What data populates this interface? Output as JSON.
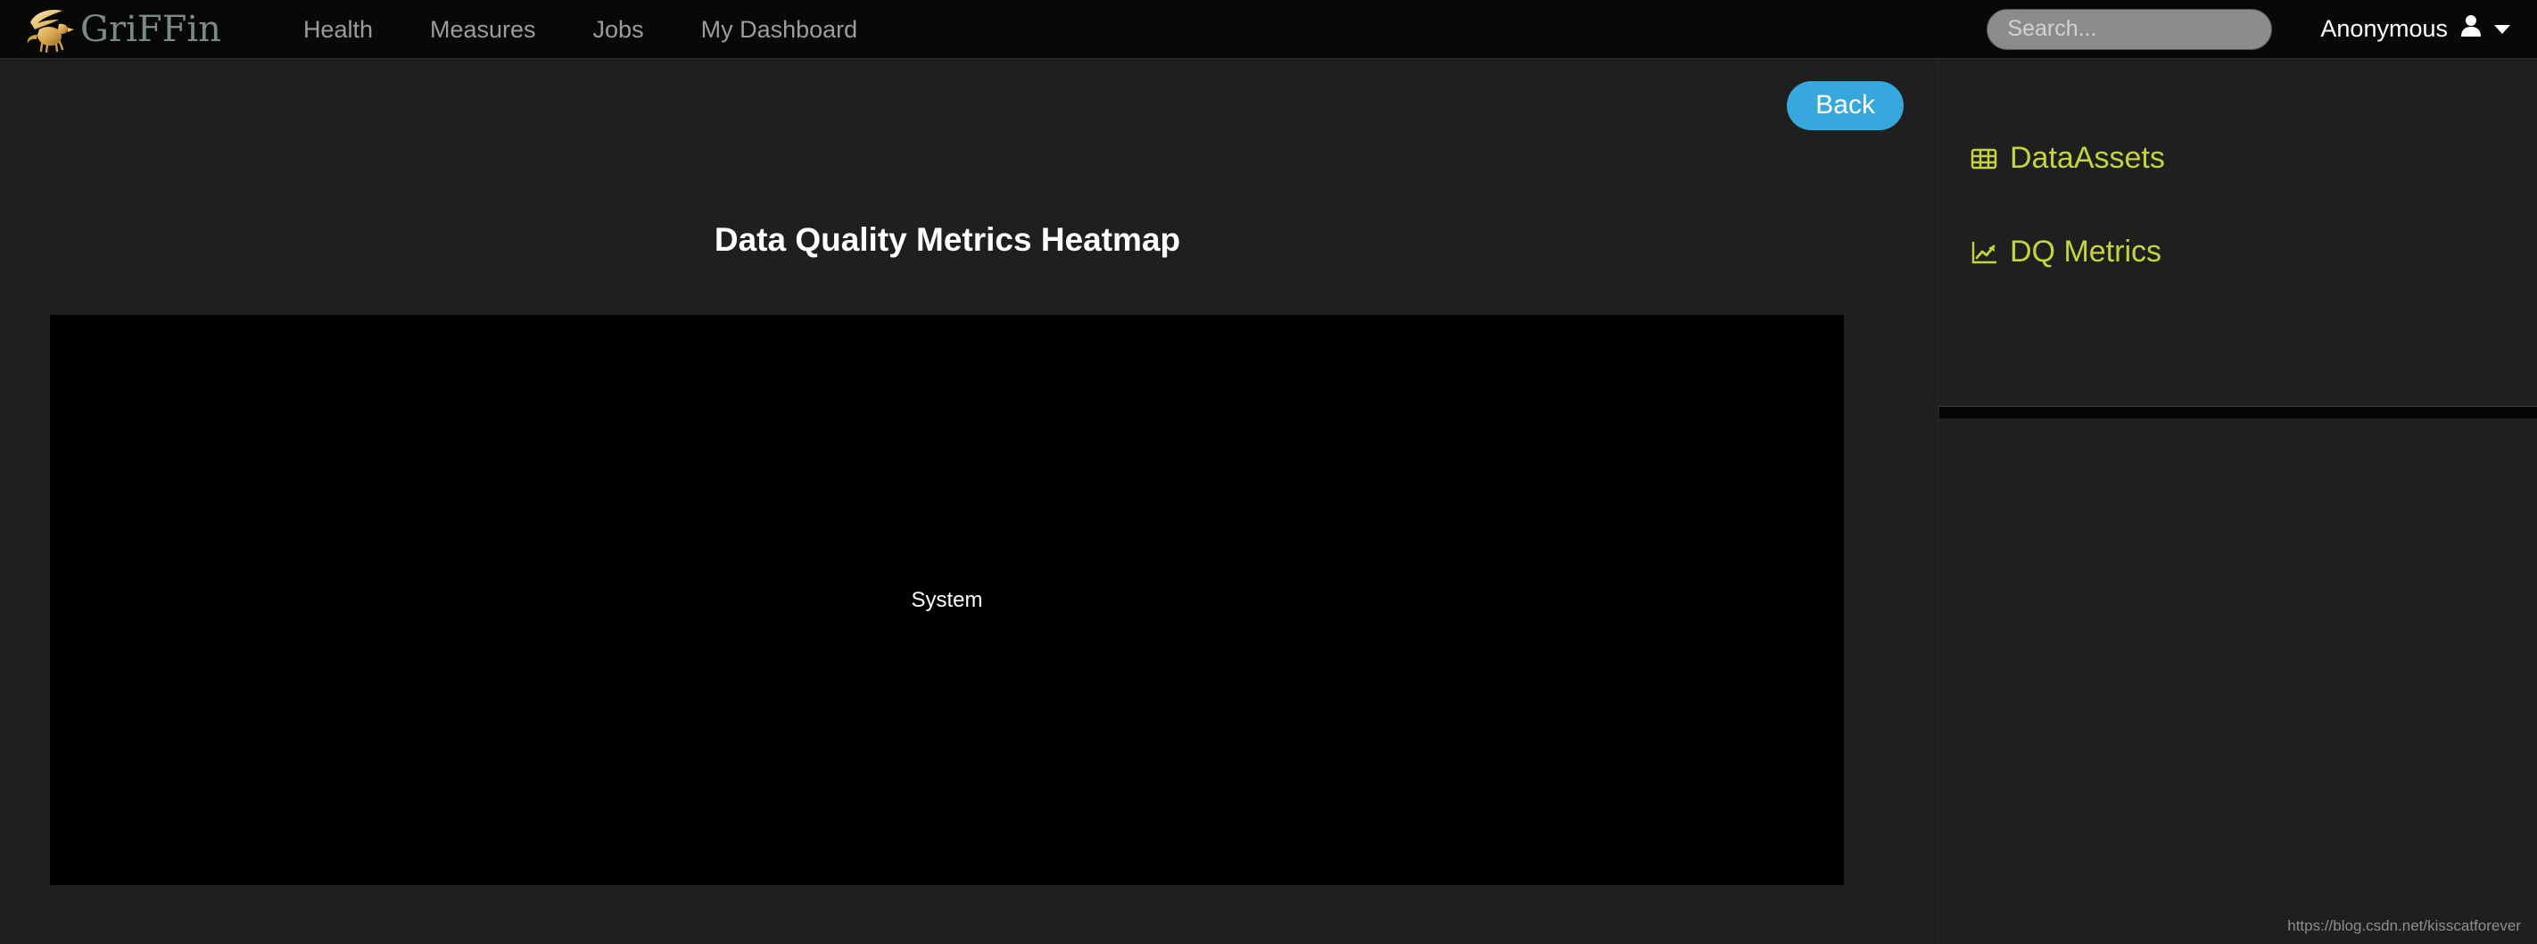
{
  "navbar": {
    "brand": {
      "text": "GriFFin",
      "logo_icon": "griffin-logo-icon"
    },
    "links": [
      {
        "label": "Health"
      },
      {
        "label": "Measures"
      },
      {
        "label": "Jobs"
      },
      {
        "label": "My Dashboard"
      }
    ],
    "search": {
      "placeholder": "Search...",
      "value": ""
    },
    "user": {
      "name": "Anonymous",
      "icon": "user-person-icon",
      "caret_icon": "chevron-down-icon"
    }
  },
  "main": {
    "back_button": "Back",
    "title": "Data Quality Metrics Heatmap",
    "heatmap": {
      "label": "System",
      "background_color": "#000000"
    }
  },
  "sidebar": {
    "items": [
      {
        "label": "DataAssets",
        "icon": "table-grid-icon"
      },
      {
        "label": "DQ Metrics",
        "icon": "line-chart-icon"
      }
    ],
    "accent_color": "#c4d53b"
  },
  "watermark": "https://blog.csdn.net/kisscatforever",
  "chart_data": {
    "type": "heatmap",
    "title": "Data Quality Metrics Heatmap",
    "annotations": [
      "System"
    ],
    "categories": [],
    "rows": [],
    "values": [],
    "xlabel": "",
    "ylabel": "",
    "legend": [],
    "note": "Heatmap canvas rendered empty (black) with single centered label 'System'"
  }
}
